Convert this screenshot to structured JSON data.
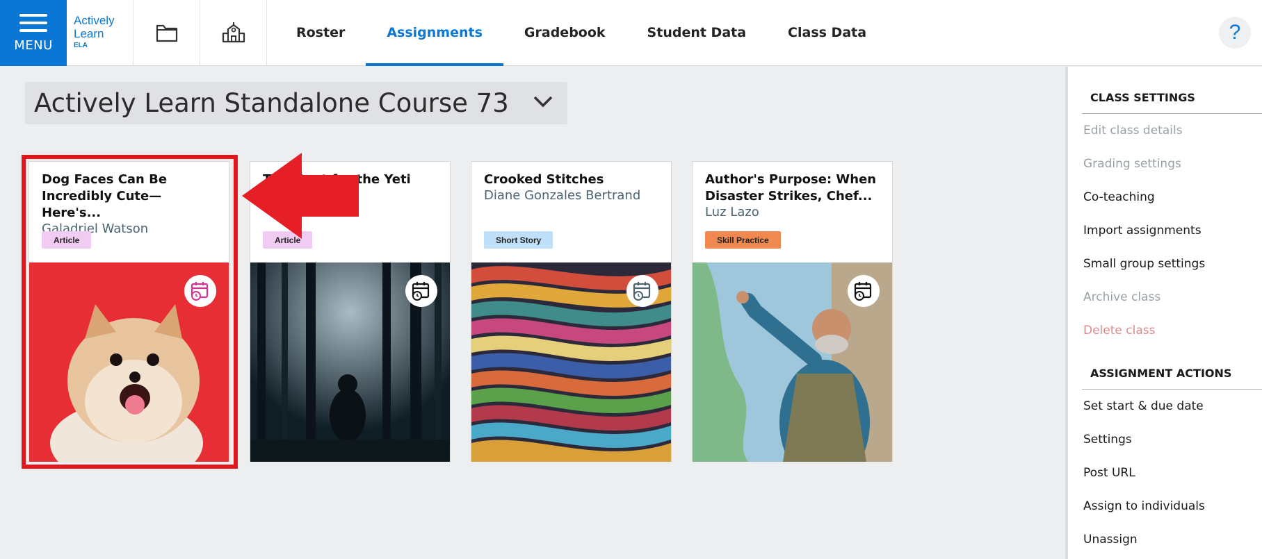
{
  "topbar": {
    "menu_label": "MENU",
    "logo": {
      "line1": "Actively",
      "line2": "Learn",
      "sub": "ELA"
    },
    "tabs": [
      {
        "label": "Roster",
        "active": false
      },
      {
        "label": "Assignments",
        "active": true
      },
      {
        "label": "Gradebook",
        "active": false
      },
      {
        "label": "Student Data",
        "active": false
      },
      {
        "label": "Class Data",
        "active": false
      }
    ],
    "help_label": "?"
  },
  "course": {
    "title": "Actively Learn Standalone Course 73"
  },
  "cards": [
    {
      "title": "Dog Faces Can Be Incredibly Cute—Here's...",
      "author": "Galadriel Watson",
      "type": "Article",
      "badge_color": "#f2cbf3",
      "icon_color": "#d6338f",
      "image": "dog"
    },
    {
      "title": "The Hunt for the Yeti",
      "author": "",
      "type": "Article",
      "badge_color": "#f2cbf3",
      "icon_color": "#111111",
      "image": "forest"
    },
    {
      "title": "Crooked Stitches",
      "author": "Diane Gonzales Bertrand",
      "type": "Short Story",
      "badge_color": "#bfe0f8",
      "icon_color": "#4a6472",
      "image": "stitches"
    },
    {
      "title": "Author's Purpose: When Disaster Strikes, Chef...",
      "author": "Luz Lazo",
      "type": "Skill Practice",
      "badge_color": "#f0894f",
      "icon_color": "#111111",
      "image": "chef"
    }
  ],
  "right_panel": {
    "class_settings": {
      "heading": "CLASS SETTINGS",
      "items": [
        {
          "label": "Edit class details",
          "state": "disabled"
        },
        {
          "label": "Grading settings",
          "state": "disabled"
        },
        {
          "label": "Co-teaching",
          "state": "normal"
        },
        {
          "label": "Import assignments",
          "state": "normal"
        },
        {
          "label": "Small group settings",
          "state": "normal"
        },
        {
          "label": "Archive class",
          "state": "disabled"
        },
        {
          "label": "Delete class",
          "state": "danger"
        }
      ]
    },
    "assignment_actions": {
      "heading": "ASSIGNMENT ACTIONS",
      "items": [
        {
          "label": "Set start & due date",
          "state": "normal"
        },
        {
          "label": "Settings",
          "state": "normal"
        },
        {
          "label": "Post URL",
          "state": "normal"
        },
        {
          "label": "Assign to individuals",
          "state": "normal"
        },
        {
          "label": "Unassign",
          "state": "normal"
        }
      ]
    }
  },
  "colors": {
    "brand": "#0a77d4",
    "highlight": "#e3161d",
    "arrow": "#e61e25"
  }
}
